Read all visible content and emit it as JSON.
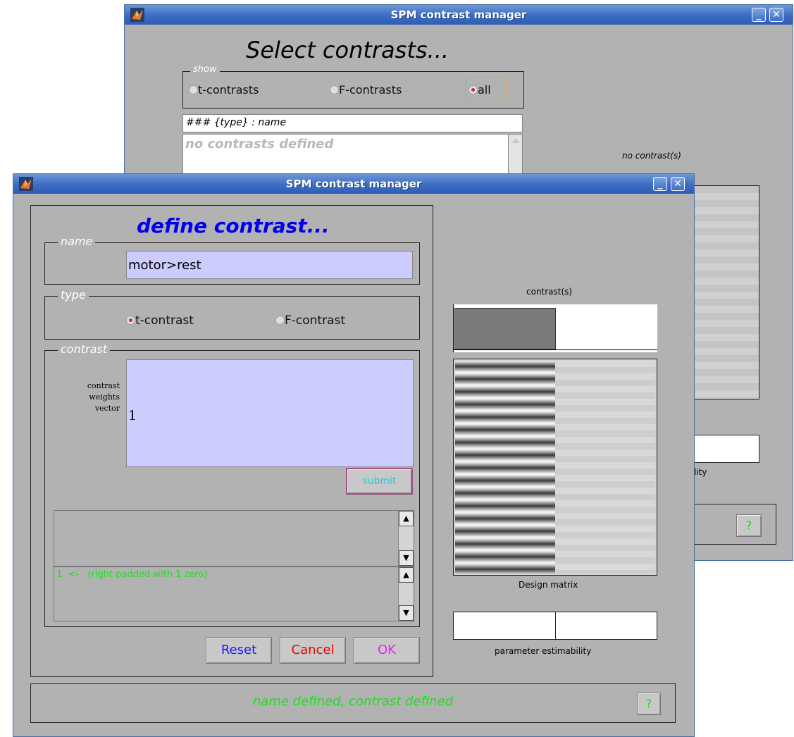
{
  "back_window": {
    "title": "SPM contrast manager",
    "heading": "Select contrasts...",
    "show_legend": "show",
    "show_options": [
      {
        "label": "t-contrasts",
        "selected": false
      },
      {
        "label": "F-contrasts",
        "selected": false
      },
      {
        "label": "all",
        "selected": true
      }
    ],
    "list_header": "### {type} : name",
    "list_empty": "no contrasts defined",
    "no_contrast_label": "no contrast(s)",
    "estimability_fragment": "lity",
    "help_label": "?"
  },
  "front_window": {
    "title": "SPM contrast manager",
    "heading": "define contrast...",
    "name_legend": "name",
    "name_value": "motor>rest",
    "type_legend": "type",
    "type_options": [
      {
        "label": "t-contrast",
        "selected": true
      },
      {
        "label": "F-contrast",
        "selected": false
      }
    ],
    "contrast_legend": "contrast",
    "weights_label": [
      "contrast",
      "weights",
      "vector"
    ],
    "weights_value": "1",
    "submit_label": "submit",
    "message_text": "1  <-   (right padded with 1 zero)",
    "buttons": {
      "reset": "Reset",
      "cancel": "Cancel",
      "ok": "OK"
    },
    "status_text": "name defined, contrast defined",
    "help_label": "?",
    "contrast_plot_label": "contrast(s)",
    "design_matrix_label": "Design matrix",
    "estimability_label": "parameter estimability"
  },
  "colors": {
    "window_bg": "#b2b2b2",
    "field_bg": "#ccccff",
    "heading_blue": "#0000ee",
    "status_green": "#22dd22",
    "reset_blue": "#1a1aff",
    "cancel_red": "#ee0000",
    "ok_magenta": "#ee22ee"
  }
}
